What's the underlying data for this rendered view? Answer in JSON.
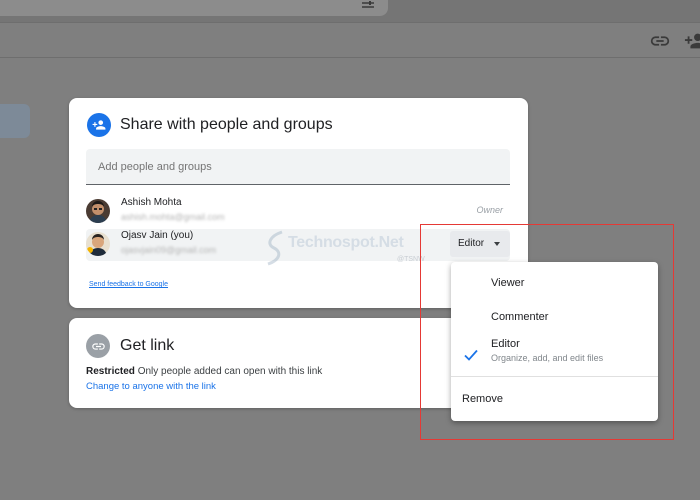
{
  "share": {
    "title": "Share with people and groups",
    "add_placeholder": "Add people and groups",
    "people": [
      {
        "name": "Ashish Mohta",
        "email": "ashish.mohta@gmail.com",
        "role": "Owner"
      },
      {
        "name": "Ojasv Jain (you)",
        "email": "ojasvjain09@gmail.com",
        "role": "Editor"
      }
    ],
    "feedback": "Send feedback to Google"
  },
  "watermark": {
    "brand": "Technospot.Net",
    "tag": "@TSNW"
  },
  "link": {
    "title": "Get link",
    "restricted_label": "Restricted",
    "restricted_desc": "Only people added can open with this link",
    "change": "Change to anyone with the link"
  },
  "role_menu": {
    "options": [
      {
        "label": "Viewer"
      },
      {
        "label": "Commenter"
      },
      {
        "label": "Editor",
        "sub": "Organize, add, and edit files",
        "selected": true
      }
    ],
    "remove": "Remove"
  },
  "icons": {
    "share": "person-add-icon",
    "link": "link-icon",
    "check": "check-icon",
    "caret": "caret-down-icon"
  },
  "colors": {
    "accent": "#1a73e8",
    "highlight": "#e53935"
  }
}
